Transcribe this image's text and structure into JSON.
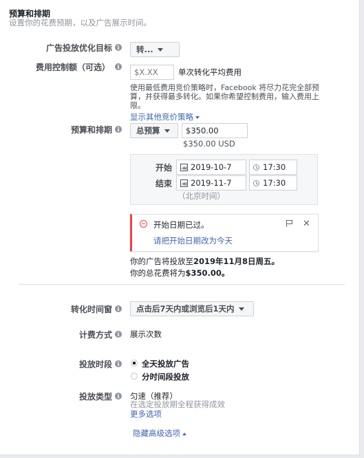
{
  "header": {
    "title": "预算和排期",
    "subtitle": "设置你的花费预期，以及广告展示时间。"
  },
  "optimization": {
    "label": "广告投放优化目标",
    "value": "转..."
  },
  "bid_cap": {
    "label": "费用控制额（可选）",
    "placeholder": "$X.XX",
    "unit": "单次转化平均费用",
    "help": "使用最低费用竞价策略时，Facebook 将尽力花完全部预算，并获得最多转化。如果你希望控制费用，输入费用上限。",
    "help_line1": "使用最低费用竞价策略时，Facebook 将尽力花完全部预",
    "help_line2": "算，并获得最多转化。如果你希望控制费用，输入费用上",
    "help_line3": "限。",
    "more_link": "显示其他竞价策略"
  },
  "budget": {
    "label": "预算和排期",
    "type": "总预算",
    "amount": "$350.00",
    "amount_note": "$350.00 USD"
  },
  "schedule": {
    "start_label": "开始",
    "start_date": "2019-10-7",
    "start_time": "17:30",
    "end_label": "结束",
    "end_date": "2019-11-7",
    "end_time": "17:30",
    "timezone": "（北京时间）"
  },
  "error": {
    "message": "开始日期已过。",
    "fix_link": "请把开始日期改为今天"
  },
  "summary": {
    "run_prefix": "你的广告将投放至",
    "run_date": "2019年11月8日周五。",
    "spend_prefix": "你的总花费将为",
    "spend_value": "$350.00。"
  },
  "conversion_window": {
    "label": "转化时间窗",
    "value": "点击后7天内或浏览后1天内"
  },
  "billing": {
    "label": "计费方式",
    "value": "展示次数"
  },
  "ad_scheduling": {
    "label": "投放时段",
    "options": [
      "全天投放广告",
      "分时间段投放"
    ],
    "selected": "全天投放广告"
  },
  "delivery_type": {
    "label": "投放类型",
    "value": "匀速（推荐）",
    "desc": "在选定投放期全程获得成效",
    "more_link": "更多选项"
  },
  "hide_advanced": "隐藏高级选项",
  "colors": {
    "link": "#4267b2",
    "error": "#fa3e3e",
    "border": "#ccd0d5"
  }
}
